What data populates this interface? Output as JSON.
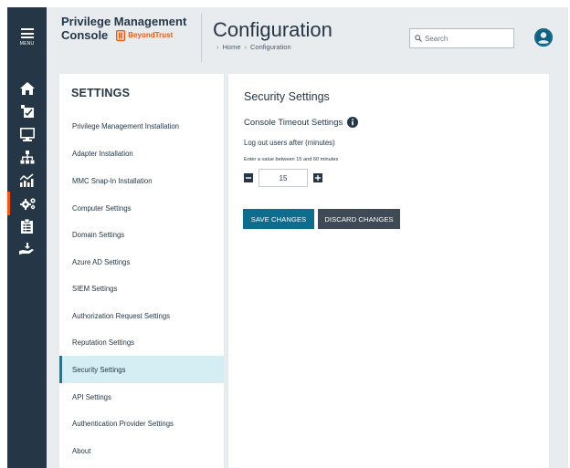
{
  "rail": {
    "menu_label": "MENU",
    "items": [
      {
        "icon": "home-icon",
        "active": false
      },
      {
        "icon": "task-icon",
        "active": false
      },
      {
        "icon": "monitor-icon",
        "active": false
      },
      {
        "icon": "hierarchy-icon",
        "active": false
      },
      {
        "icon": "analytics-icon",
        "active": false
      },
      {
        "icon": "gears-icon",
        "active": true
      },
      {
        "icon": "clipboard-icon",
        "active": false
      },
      {
        "icon": "hand-download-icon",
        "active": false
      }
    ]
  },
  "header": {
    "brand_line1": "Privilege Management",
    "brand_line2": "Console",
    "logo_text": "BeyondTrust",
    "title": "Configuration",
    "breadcrumb": [
      "Home",
      "Configuration"
    ],
    "search_placeholder": "Search"
  },
  "settings_nav": {
    "heading": "SETTINGS",
    "items": [
      "Privilege Management Installation",
      "Adapter Installation",
      "MMC Snap-In Installation",
      "Computer Settings",
      "Domain Settings",
      "Azure AD Settings",
      "SIEM Settings",
      "Authorization Request Settings",
      "Reputation Settings",
      "Security Settings",
      "API Settings",
      "Authentication Provider Settings",
      "About"
    ],
    "active": "Security Settings"
  },
  "content": {
    "title": "Security Settings",
    "section": "Console Timeout Settings",
    "field_label": "Log out users after (minutes)",
    "hint": "Enter a value between 15 and 60 minutes",
    "timeout_value": "15",
    "save_label": "SAVE CHANGES",
    "discard_label": "DISCARD CHANGES"
  },
  "colors": {
    "rail_bg": "#253746",
    "accent_orange": "#ff5500",
    "save_button": "#0c6d8f",
    "discard_button": "#3e4b57",
    "active_item_bg": "#d4eef4"
  }
}
